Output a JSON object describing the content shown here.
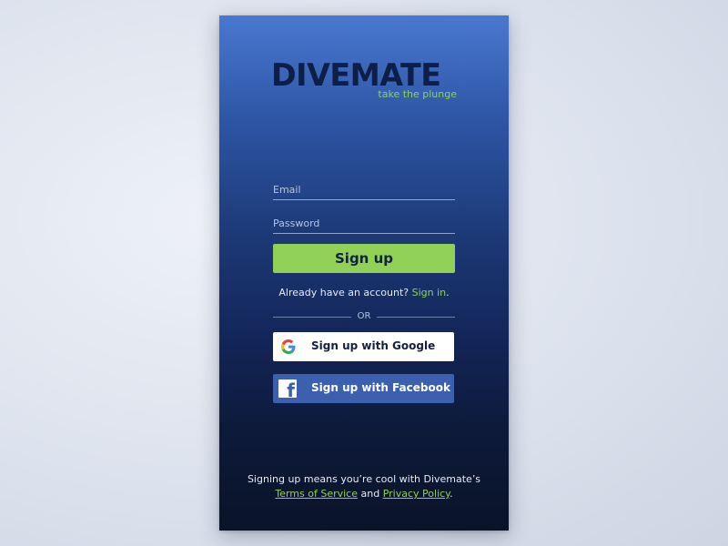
{
  "brand": {
    "name": "DIVEMATE",
    "tagline": "take the plunge"
  },
  "form": {
    "email_placeholder": "Email",
    "password_placeholder": "Password",
    "signup_label": "Sign up"
  },
  "signin": {
    "prefix": "Already have an account? ",
    "link": "Sign in",
    "suffix": "."
  },
  "divider": {
    "label": "OR"
  },
  "social": {
    "google_label": "Sign up with Google",
    "facebook_label": "Sign up with Facebook",
    "google_icon": "google-icon",
    "facebook_icon": "facebook-icon"
  },
  "legal": {
    "line1": "Signing up means you’re cool with Divemate’s",
    "terms_link": "Terms of Service",
    "and": " and ",
    "privacy_link": "Privacy Policy",
    "end": "."
  },
  "colors": {
    "accent_green": "#92d158",
    "facebook_blue": "#3c5fae",
    "logo_navy": "#0e1f47"
  }
}
